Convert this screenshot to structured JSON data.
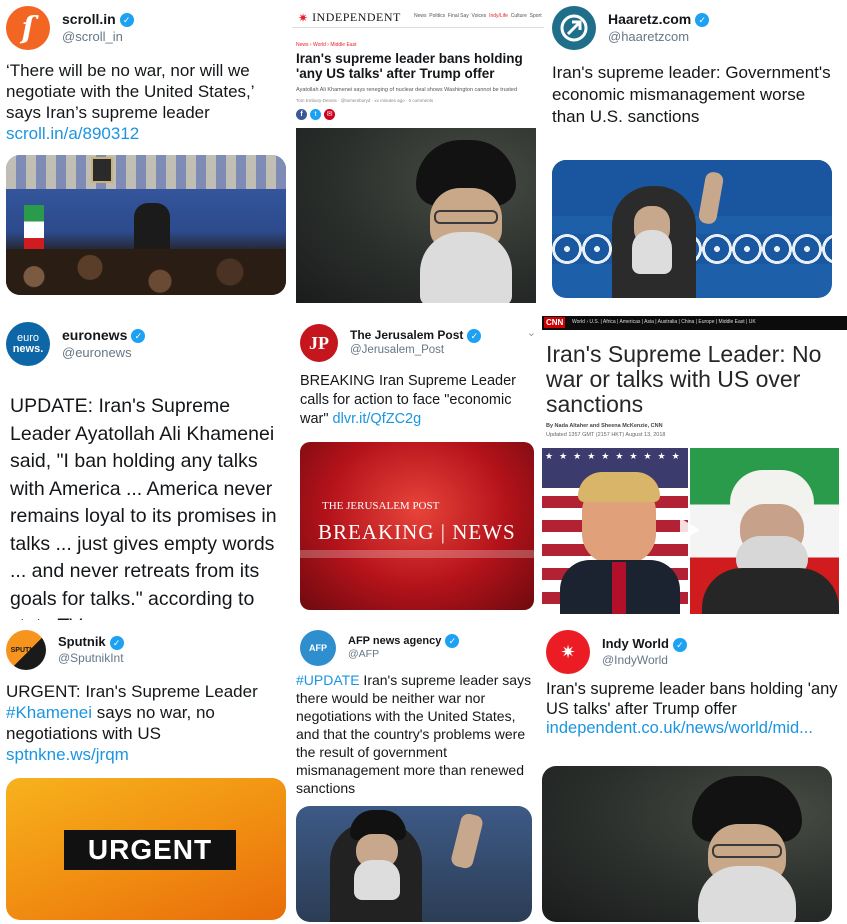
{
  "c1": {
    "name": "scroll.in",
    "handle": "@scroll_in",
    "avatar_letter": "ſ",
    "avatar_color": "#f26522",
    "text": "‘There will be no war, nor will we negotiate with the United States,’ says Iran’s supreme leader",
    "link": "scroll.in/a/890312"
  },
  "c2": {
    "brand": "INDEPENDENT",
    "nav": [
      "News",
      "Politics",
      "Final Say",
      "Voices",
      "IndyLife",
      "Indy/Life",
      "Culture",
      "Sport"
    ],
    "section": "News › World › Middle East",
    "headline": "Iran's supreme leader bans holding 'any US talks' after Trump offer",
    "standfirst": "Ayatollah Ali Khamenei says reneging of nuclear deal shows Washington cannot be trusted",
    "byline": "Tom Embury-Dennis · @tomemburyd · xx minutes ago · 0 comments"
  },
  "c3": {
    "name": "Haaretz.com",
    "handle": "@haaretzcom",
    "avatar_color": "#1f6f8b",
    "text": "Iran's supreme leader: Government's economic mismanagement worse than U.S. sanctions"
  },
  "c4": {
    "name": "euronews",
    "handle": "@euronews",
    "avatar_color": "#0d66a5",
    "avatar_text_1": "euro",
    "avatar_text_2": "news.",
    "text": "UPDATE: Iran's Supreme Leader Ayatollah Ali Khamenei said, \"I ban holding any talks with America ... America never remains loyal to its promises in talks ... just gives empty words ... and never retreats from its goals for talks.\" according to state TV."
  },
  "c5": {
    "name": "The Jerusalem Post",
    "handle": "@Jerusalem_Post",
    "avatar_color": "#c4161c",
    "avatar_text": "JP",
    "text": "BREAKING Iran Supreme Leader calls for action to face \"economic war\"",
    "link": "dlvr.it/QfZC2g",
    "card_brand": "THE JERUSALEM POST",
    "card_text": "BREAKING | NEWS"
  },
  "c6": {
    "logo": "CNN",
    "nav": "World › U.S. | Africa | Americas | Asia | Australia | China | Europe | Middle East | UK",
    "headline": "Iran's Supreme Leader: No war or talks with US over sanctions",
    "byline": "By Nada Altaher and Sheena McKenzie, CNN",
    "updated": "Updated 1357 GMT (2157 HKT) August 13, 2018"
  },
  "c7": {
    "name": "Sputnik",
    "handle": "@SputnikInt",
    "avatar_color": "#f7941d",
    "avatar_text": "SPUTNIK",
    "text_1": "URGENT: Iran's Supreme Leader ",
    "hashtag": "#Khamenei",
    "text_2": " says no war, no negotiations with US ",
    "link": "sptnkne.ws/jrqm",
    "card_text": "URGENT"
  },
  "c8": {
    "name": "AFP news agency",
    "handle": "@AFP",
    "avatar_color": "#2f8fce",
    "avatar_text": "AFP",
    "hashtag": "#UPDATE",
    "text": " Iran's supreme leader says there would be neither war nor negotiations with the United States, and that the country's problems were the result of government mismanagement more than renewed sanctions"
  },
  "c9": {
    "name": "Indy World",
    "handle": "@IndyWorld",
    "avatar_color": "#ec1c24",
    "text": "Iran's supreme leader bans holding 'any US talks' after Trump offer ",
    "link": "independent.co.uk/news/world/mid..."
  }
}
